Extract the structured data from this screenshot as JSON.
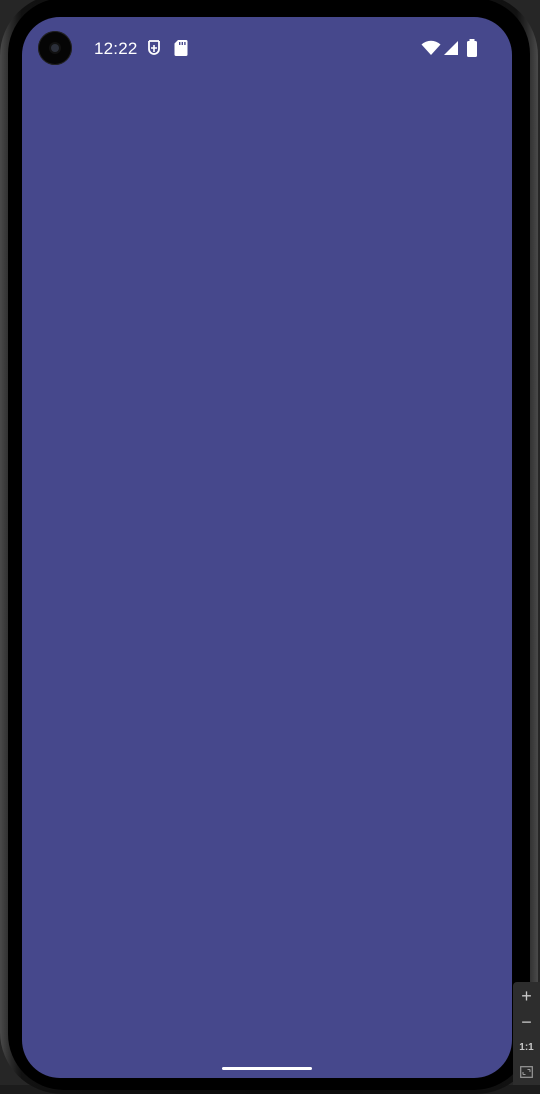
{
  "colors": {
    "screen_bg": "#46488c",
    "status_icon": "#ffffff",
    "nav_handle": "#ffffff"
  },
  "status_bar": {
    "time": "12:22",
    "left_icons": [
      "data-saver-icon",
      "sd-card-icon"
    ],
    "right_icons": [
      "wifi-icon",
      "cellular-signal-icon",
      "battery-icon"
    ]
  },
  "emulator_toolbar": {
    "zoom_in": "+",
    "zoom_out": "−",
    "actual_size": "1:1",
    "fit_icon": "fit-screen-icon"
  }
}
